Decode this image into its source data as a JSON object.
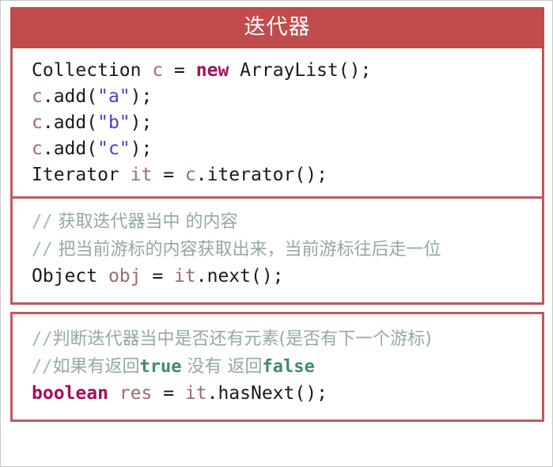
{
  "header": {
    "title": "迭代器",
    "bg_color": "#C04C4C",
    "text_color": "#FFFFFF"
  },
  "theme": {
    "border_color": "#C0595C",
    "page_border_color": "#C9C9C9",
    "background": "#FFFFFF",
    "keyword_color": "#A3105E",
    "string_color": "#4B3BD8",
    "variable_color": "#9E6B6B",
    "type_color": "#1A1A1A",
    "comment_color": "#93AB9E",
    "comment_literal_color": "#3F8A72"
  },
  "blocks": [
    {
      "id": "block-1",
      "lines": [
        {
          "kind": "code",
          "text": "Collection c = new ArrayList();",
          "tokens": [
            {
              "t": "Collection",
              "c": "type"
            },
            {
              "t": " ",
              "c": "plain"
            },
            {
              "t": "c",
              "c": "var"
            },
            {
              "t": " = ",
              "c": "plain"
            },
            {
              "t": "new",
              "c": "kw"
            },
            {
              "t": " ",
              "c": "plain"
            },
            {
              "t": "ArrayList();",
              "c": "type"
            }
          ]
        },
        {
          "kind": "code",
          "text": "c.add(\"a\");",
          "tokens": [
            {
              "t": "c",
              "c": "var"
            },
            {
              "t": ".add(",
              "c": "plain"
            },
            {
              "t": "\"a\"",
              "c": "str"
            },
            {
              "t": ");",
              "c": "plain"
            }
          ]
        },
        {
          "kind": "code",
          "text": "c.add(\"b\");",
          "tokens": [
            {
              "t": "c",
              "c": "var"
            },
            {
              "t": ".add(",
              "c": "plain"
            },
            {
              "t": "\"b\"",
              "c": "str"
            },
            {
              "t": ");",
              "c": "plain"
            }
          ]
        },
        {
          "kind": "code",
          "text": "c.add(\"c\");",
          "tokens": [
            {
              "t": "c",
              "c": "var"
            },
            {
              "t": ".add(",
              "c": "plain"
            },
            {
              "t": "\"c\"",
              "c": "str"
            },
            {
              "t": ");",
              "c": "plain"
            }
          ]
        },
        {
          "kind": "code",
          "text": "Iterator it = c.iterator();",
          "tokens": [
            {
              "t": "Iterator",
              "c": "type"
            },
            {
              "t": " ",
              "c": "plain"
            },
            {
              "t": "it",
              "c": "var"
            },
            {
              "t": " = ",
              "c": "plain"
            },
            {
              "t": "c",
              "c": "var"
            },
            {
              "t": ".iterator();",
              "c": "plain"
            }
          ]
        }
      ]
    },
    {
      "id": "block-2",
      "lines": [
        {
          "kind": "comment",
          "text": "// 获取迭代器当中 的内容",
          "tokens": [
            {
              "t": "//",
              "c": "slashes"
            },
            {
              "t": " 获取迭代器当中 的内容",
              "c": "cjk"
            }
          ]
        },
        {
          "kind": "comment",
          "text": "// 把当前游标的内容获取出来，当前游标往后走一位",
          "tokens": [
            {
              "t": "//",
              "c": "slashes"
            },
            {
              "t": " 把当前游标的内容获取出来，当前游标往后走一位",
              "c": "cjk"
            }
          ]
        },
        {
          "kind": "code",
          "text": "Object obj = it.next();",
          "tokens": [
            {
              "t": "Object",
              "c": "type"
            },
            {
              "t": " ",
              "c": "plain"
            },
            {
              "t": "obj",
              "c": "var"
            },
            {
              "t": " = ",
              "c": "plain"
            },
            {
              "t": "it",
              "c": "var"
            },
            {
              "t": ".next();",
              "c": "plain"
            }
          ]
        }
      ]
    },
    {
      "id": "block-3",
      "lines": [
        {
          "kind": "comment",
          "text": "//判断迭代器当中是否还有元素(是否有下一个游标)",
          "tokens": [
            {
              "t": "//",
              "c": "slashes"
            },
            {
              "t": "判断迭代器当中是否还有元素(是否有下一个游标)",
              "c": "cjk"
            }
          ]
        },
        {
          "kind": "comment",
          "text": "//如果有返回true 没有 返回false",
          "tokens": [
            {
              "t": "//",
              "c": "slashes"
            },
            {
              "t": "如果有返回",
              "c": "cjk"
            },
            {
              "t": "true",
              "c": "lit"
            },
            {
              "t": " 没有 返回",
              "c": "cjk"
            },
            {
              "t": "false",
              "c": "lit"
            }
          ]
        },
        {
          "kind": "code",
          "text": "boolean res = it.hasNext();",
          "tokens": [
            {
              "t": "boolean",
              "c": "kw"
            },
            {
              "t": " ",
              "c": "plain"
            },
            {
              "t": "res",
              "c": "var"
            },
            {
              "t": " = ",
              "c": "plain"
            },
            {
              "t": "it",
              "c": "var"
            },
            {
              "t": ".hasNext();",
              "c": "plain"
            }
          ]
        }
      ]
    }
  ]
}
